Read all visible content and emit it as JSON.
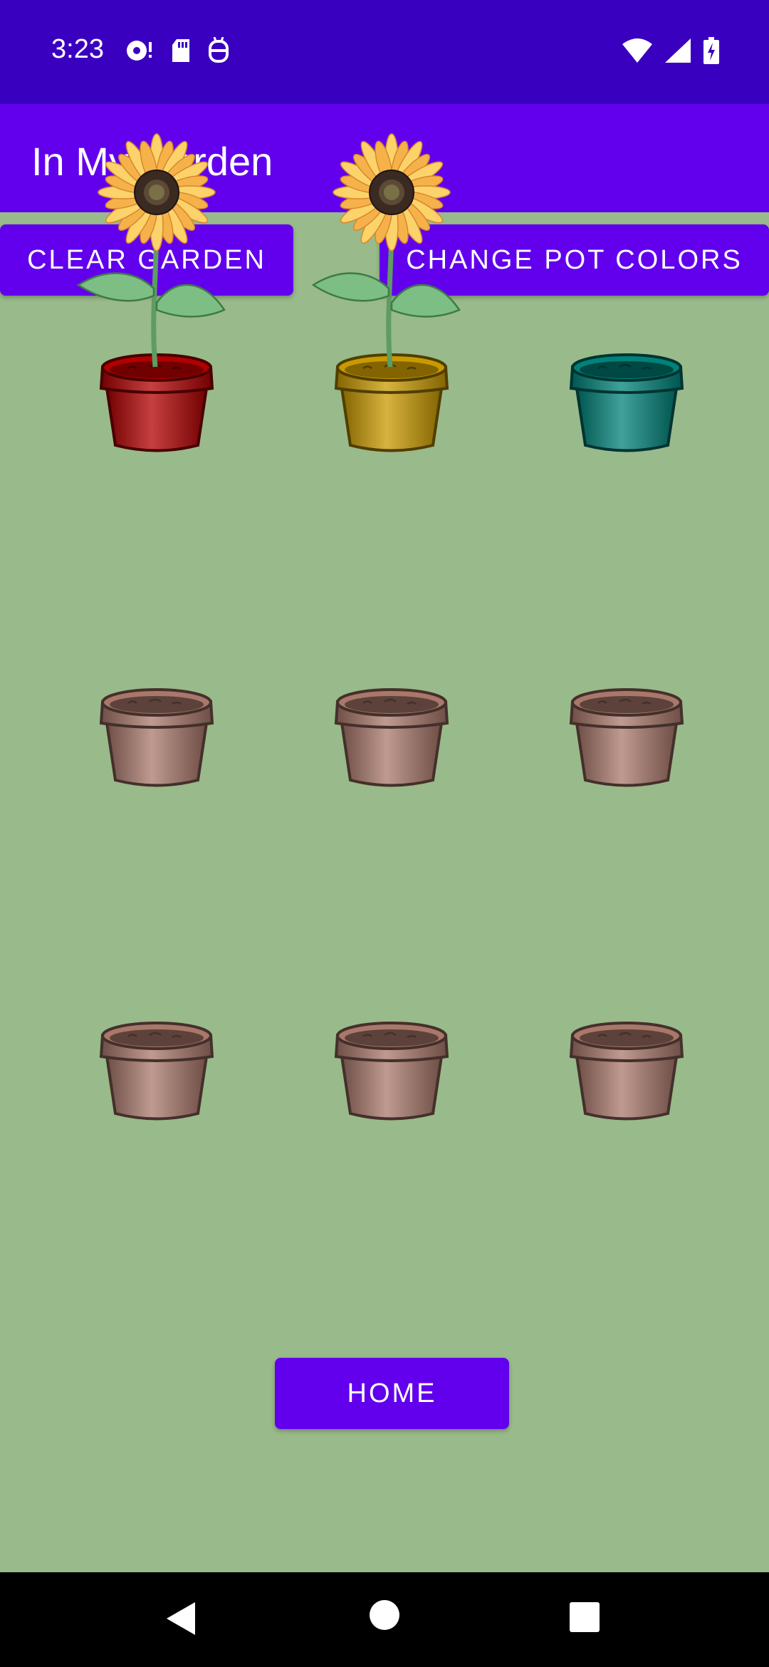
{
  "status_bar": {
    "time": "3:23",
    "left_icons": [
      "podcast-notification-icon",
      "sd-card-icon",
      "robot-debug-icon"
    ],
    "right_icons": [
      "wifi-icon",
      "cell-signal-icon",
      "battery-charging-icon"
    ]
  },
  "app_bar": {
    "title": "In My Garden"
  },
  "buttons": {
    "clear_garden": "CLEAR GARDEN",
    "change_pot_colors": "CHANGE POT COLORS",
    "home": "HOME"
  },
  "garden": {
    "plots": [
      {
        "pot_color": "#B10000",
        "flower": "sunflower"
      },
      {
        "pot_color": "#C99A00",
        "flower": "sunflower"
      },
      {
        "pot_color": "#00827A",
        "flower": "none"
      },
      {
        "pot_color": "#A9786B",
        "flower": "none"
      },
      {
        "pot_color": "#A9786B",
        "flower": "none"
      },
      {
        "pot_color": "#A9786B",
        "flower": "none"
      },
      {
        "pot_color": "#A9786B",
        "flower": "none"
      },
      {
        "pot_color": "#A9786B",
        "flower": "none"
      },
      {
        "pot_color": "#A9786B",
        "flower": "none"
      }
    ]
  },
  "colors": {
    "status_bar": "#3A00BF",
    "app_bar": "#6200EE",
    "background": "#99BA8A"
  },
  "nav_bar": {
    "icons": [
      "back-icon",
      "home-icon",
      "recents-icon"
    ]
  }
}
